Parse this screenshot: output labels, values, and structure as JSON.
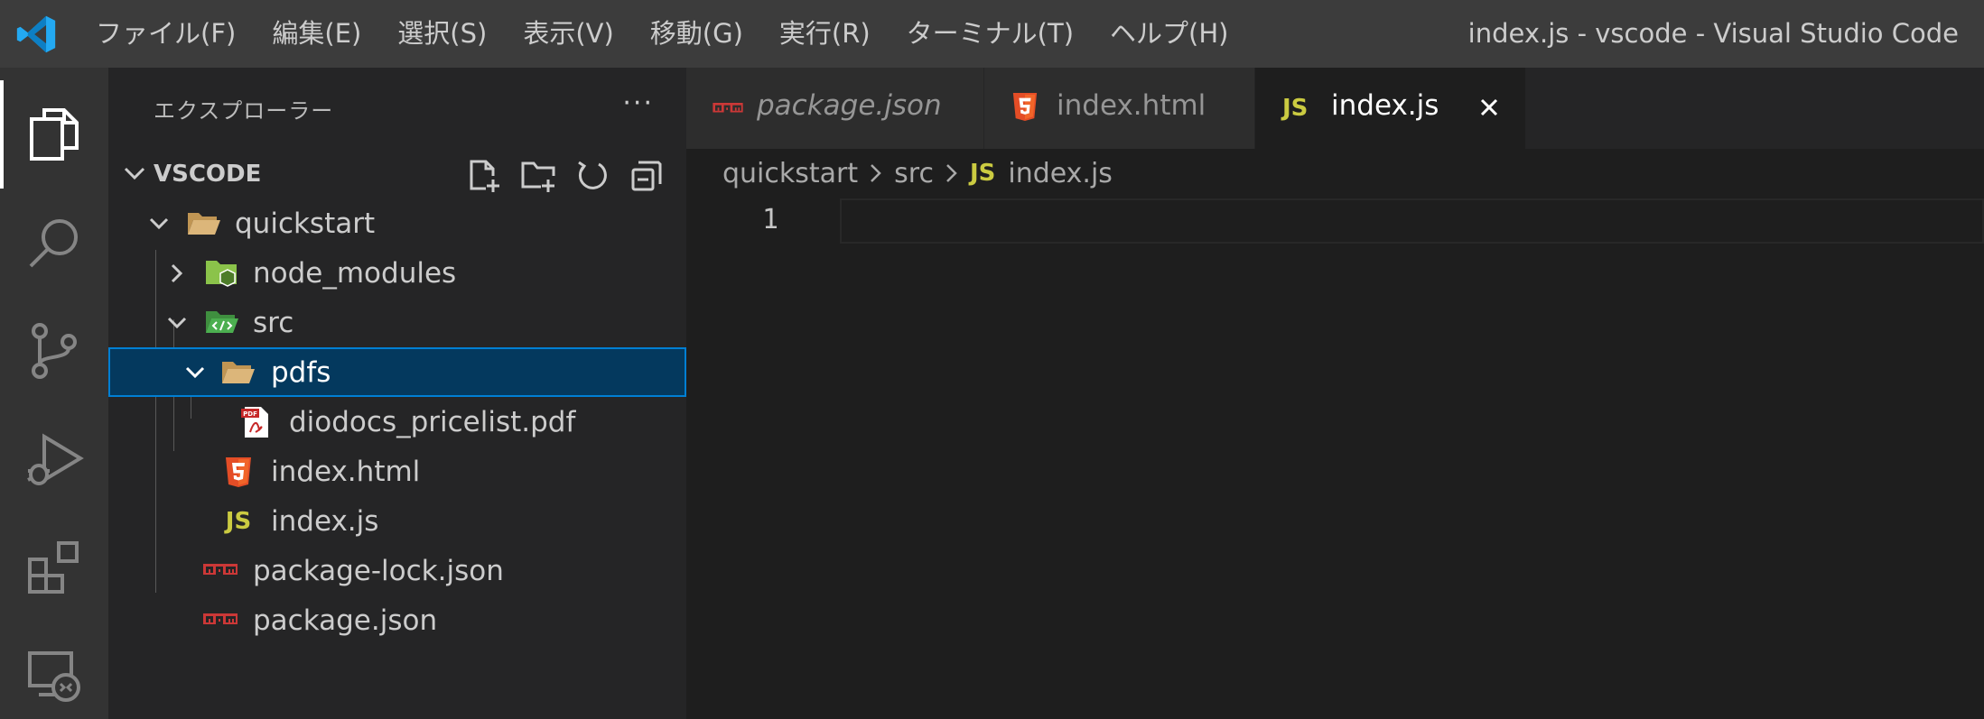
{
  "titlebar": {
    "app_icon": "vscode-logo",
    "menu": [
      "ファイル(F)",
      "編集(E)",
      "選択(S)",
      "表示(V)",
      "移動(G)",
      "実行(R)",
      "ターミナル(T)",
      "ヘルプ(H)"
    ],
    "window_title": "index.js - vscode - Visual Studio Code"
  },
  "activitybar": {
    "items": [
      {
        "icon": "files-icon",
        "active": true
      },
      {
        "icon": "search-icon",
        "active": false
      },
      {
        "icon": "source-control-icon",
        "active": false
      },
      {
        "icon": "run-debug-icon",
        "active": false
      },
      {
        "icon": "extensions-icon",
        "active": false
      },
      {
        "icon": "remote-explorer-icon",
        "active": false
      }
    ]
  },
  "sidebar": {
    "title": "エクスプローラー",
    "more": "···",
    "section_title": "VSCODE",
    "section_actions": [
      "new-file-icon",
      "new-folder-icon",
      "refresh-icon",
      "collapse-all-icon"
    ],
    "tree": [
      {
        "label": "quickstart",
        "kind": "folder",
        "expanded": true,
        "depth": 0
      },
      {
        "label": "node_modules",
        "kind": "folder-node",
        "expanded": false,
        "depth": 1
      },
      {
        "label": "src",
        "kind": "folder-src",
        "expanded": true,
        "depth": 1
      },
      {
        "label": "pdfs",
        "kind": "folder",
        "expanded": true,
        "depth": 2,
        "selected": true
      },
      {
        "label": "diodocs_pricelist.pdf",
        "kind": "pdf",
        "depth": 3
      },
      {
        "label": "index.html",
        "kind": "html",
        "depth": 2
      },
      {
        "label": "index.js",
        "kind": "js",
        "depth": 2
      },
      {
        "label": "package-lock.json",
        "kind": "npm",
        "depth": 1
      },
      {
        "label": "package.json",
        "kind": "npm",
        "depth": 1
      }
    ]
  },
  "tabs": [
    {
      "label": "package.json",
      "icon": "npm-icon",
      "italic": true,
      "active": false
    },
    {
      "label": "index.html",
      "icon": "html5-icon",
      "italic": false,
      "active": false
    },
    {
      "label": "index.js",
      "icon": "js-icon",
      "italic": false,
      "active": true
    }
  ],
  "breadcrumb": [
    "quickstart",
    "src",
    "index.js"
  ],
  "editor": {
    "line_numbers": [
      "1"
    ]
  },
  "icon_text": {
    "js": "JS",
    "node": "JS",
    "pdf": "PDF"
  },
  "colors": {
    "accent": "#007fd4",
    "selection": "#04395e",
    "vscode_blue": "#23a9f2",
    "js_yellow": "#cbcb41",
    "html_orange": "#e44d26",
    "npm_red": "#cb3837"
  }
}
